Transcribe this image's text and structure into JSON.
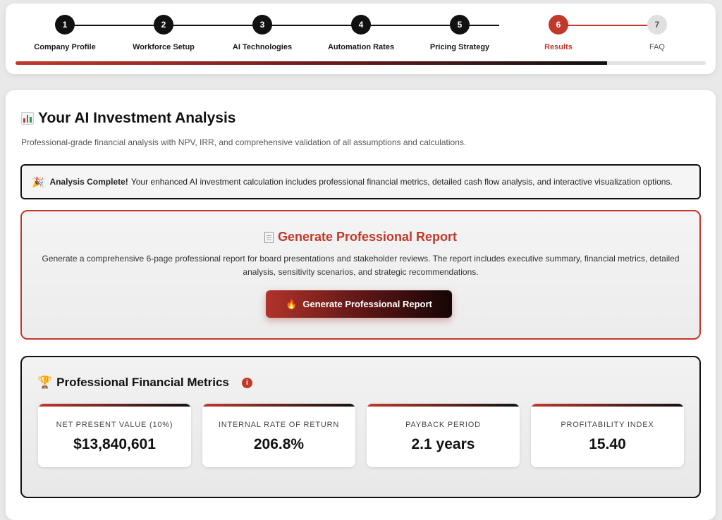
{
  "stepper": {
    "steps": [
      {
        "number": "1",
        "label": "Company Profile",
        "state": "done"
      },
      {
        "number": "2",
        "label": "Workforce Setup",
        "state": "done"
      },
      {
        "number": "3",
        "label": "AI Technologies",
        "state": "done"
      },
      {
        "number": "4",
        "label": "Automation Rates",
        "state": "done"
      },
      {
        "number": "5",
        "label": "Pricing Strategy",
        "state": "done"
      },
      {
        "number": "6",
        "label": "Results",
        "state": "active"
      },
      {
        "number": "7",
        "label": "FAQ",
        "state": "pending"
      }
    ],
    "progress_fraction": 0.857
  },
  "page": {
    "title": "Your AI Investment Analysis",
    "title_icon": "bar-chart-icon",
    "subtitle": "Professional-grade financial analysis with NPV, IRR, and comprehensive validation of all assumptions and calculations."
  },
  "alert": {
    "icon": "party-popper-icon",
    "bold": "Analysis Complete!",
    "text": "Your enhanced AI investment calculation includes professional financial metrics, detailed cash flow analysis, and interactive visualization options."
  },
  "report": {
    "title": "Generate Professional Report",
    "title_icon": "document-icon",
    "description": "Generate a comprehensive 6-page professional report for board presentations and stakeholder reviews. The report includes executive summary, financial metrics, detailed analysis, sensitivity scenarios, and strategic recommendations.",
    "button_label": "Generate Professional Report",
    "button_icon": "fire-icon"
  },
  "metrics": {
    "title": "Professional Financial Metrics",
    "title_icon": "trophy-icon",
    "items": [
      {
        "label": "NET PRESENT VALUE (10%)",
        "value": "$13,840,601"
      },
      {
        "label": "INTERNAL RATE OF RETURN",
        "value": "206.8%"
      },
      {
        "label": "PAYBACK PERIOD",
        "value": "2.1 years"
      },
      {
        "label": "PROFITABILITY INDEX",
        "value": "15.40"
      }
    ]
  },
  "colors": {
    "accent": "#c0392b",
    "dark": "#111111",
    "pending": "#e0e0e0"
  }
}
